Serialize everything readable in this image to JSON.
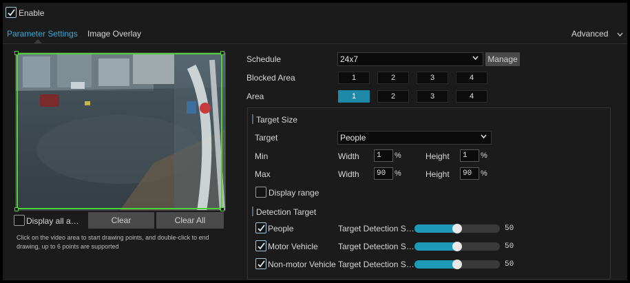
{
  "enable": {
    "label": "Enable",
    "checked": true
  },
  "tabs": [
    {
      "label": "Parameter Settings",
      "active": true
    },
    {
      "label": "Image Overlay",
      "active": false
    }
  ],
  "advanced": {
    "label": "Advanced"
  },
  "video": {
    "overlay_text": "",
    "display_all": {
      "label": "Display all a…",
      "checked": false
    },
    "clear_label": "Clear",
    "clear_all_label": "Clear All",
    "hint": "Click on the video area to start drawing points, and double-click to end drawing, up to 6 points are supported"
  },
  "schedule": {
    "label": "Schedule",
    "value": "24x7",
    "manage_label": "Manage"
  },
  "blocked_area": {
    "label": "Blocked Area",
    "options": [
      "1",
      "2",
      "3",
      "4"
    ]
  },
  "area": {
    "label": "Area",
    "options": [
      "1",
      "2",
      "3",
      "4"
    ],
    "selected": "1"
  },
  "target_size": {
    "title": "Target Size",
    "target_label": "Target",
    "target_value": "People",
    "min": {
      "label": "Min",
      "width_label": "Width",
      "width": "1",
      "height_label": "Height",
      "height": "1",
      "unit": "%"
    },
    "max": {
      "label": "Max",
      "width_label": "Width",
      "width": "90",
      "height_label": "Height",
      "height": "90",
      "unit": "%"
    },
    "display_range": {
      "label": "Display range",
      "checked": false
    }
  },
  "detection_target": {
    "title": "Detection Target",
    "items": [
      {
        "label": "People",
        "checked": true,
        "sens_label": "Target Detection S…",
        "value": 50,
        "value_text": "50"
      },
      {
        "label": "Motor Vehicle",
        "checked": true,
        "sens_label": "Target Detection S…",
        "value": 50,
        "value_text": "50"
      },
      {
        "label": "Non-motor Vehicle",
        "checked": true,
        "sens_label": "Target Detection S…",
        "value": 50,
        "value_text": "50"
      }
    ]
  },
  "colors": {
    "accent": "#3fa9d6",
    "selected_box": "#1e8aa8",
    "slider_fill": "#1e9ab8",
    "region_outline": "#4cd33a"
  }
}
